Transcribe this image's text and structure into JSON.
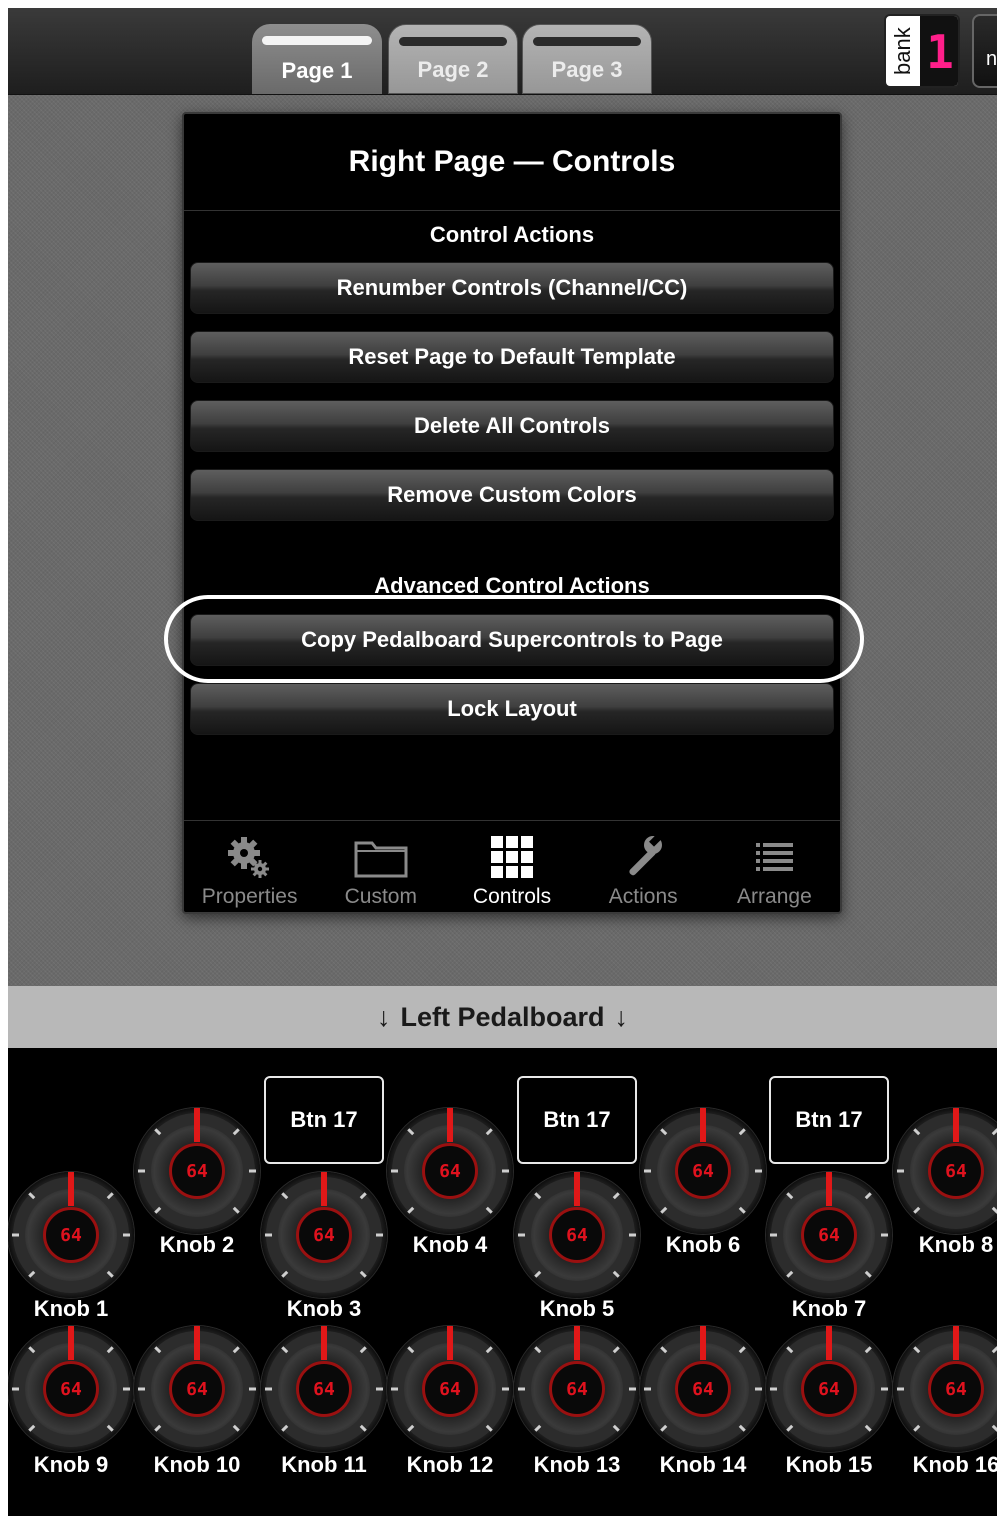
{
  "tabs": [
    {
      "label": "Page 1",
      "active": true
    },
    {
      "label": "Page 2",
      "active": false
    },
    {
      "label": "Page 3",
      "active": false
    }
  ],
  "bank": {
    "label": "bank",
    "display": "1"
  },
  "next_button": {
    "label": "n"
  },
  "popover": {
    "title": "Right Page — Controls",
    "section_actions": "Control Actions",
    "actions": [
      "Renumber Controls (Channel/CC)",
      "Reset Page to Default Template",
      "Delete All Controls",
      "Remove Custom Colors"
    ],
    "section_advanced": "Advanced Control Actions",
    "advanced": [
      "Copy Pedalboard Supercontrols to Page",
      "Lock Layout"
    ],
    "toolbar": [
      {
        "label": "Properties",
        "icon": "gears-icon",
        "active": false
      },
      {
        "label": "Custom",
        "icon": "folder-icon",
        "active": false
      },
      {
        "label": "Controls",
        "icon": "grid-icon",
        "active": true
      },
      {
        "label": "Actions",
        "icon": "wrench-icon",
        "active": false
      },
      {
        "label": "Arrange",
        "icon": "list-icon",
        "active": false
      }
    ]
  },
  "banner": {
    "arrow_left": "↓",
    "text": "Left Pedalboard",
    "arrow_right": "↓"
  },
  "knob_value": "64",
  "pads": [
    "Btn 17",
    "Btn 17",
    "Btn 17"
  ],
  "knobs": [
    "Knob 1",
    "Knob 2",
    "Knob 3",
    "Knob 4",
    "Knob 5",
    "Knob 6",
    "Knob 7",
    "Knob 8",
    "Knob 9",
    "Knob 10",
    "Knob 11",
    "Knob 12",
    "Knob 13",
    "Knob 14",
    "Knob 15",
    "Knob 16"
  ],
  "colors": {
    "knob_value": "#e0121e",
    "bank_digit": "#ff1f8a",
    "popover_bg": "#000000"
  }
}
